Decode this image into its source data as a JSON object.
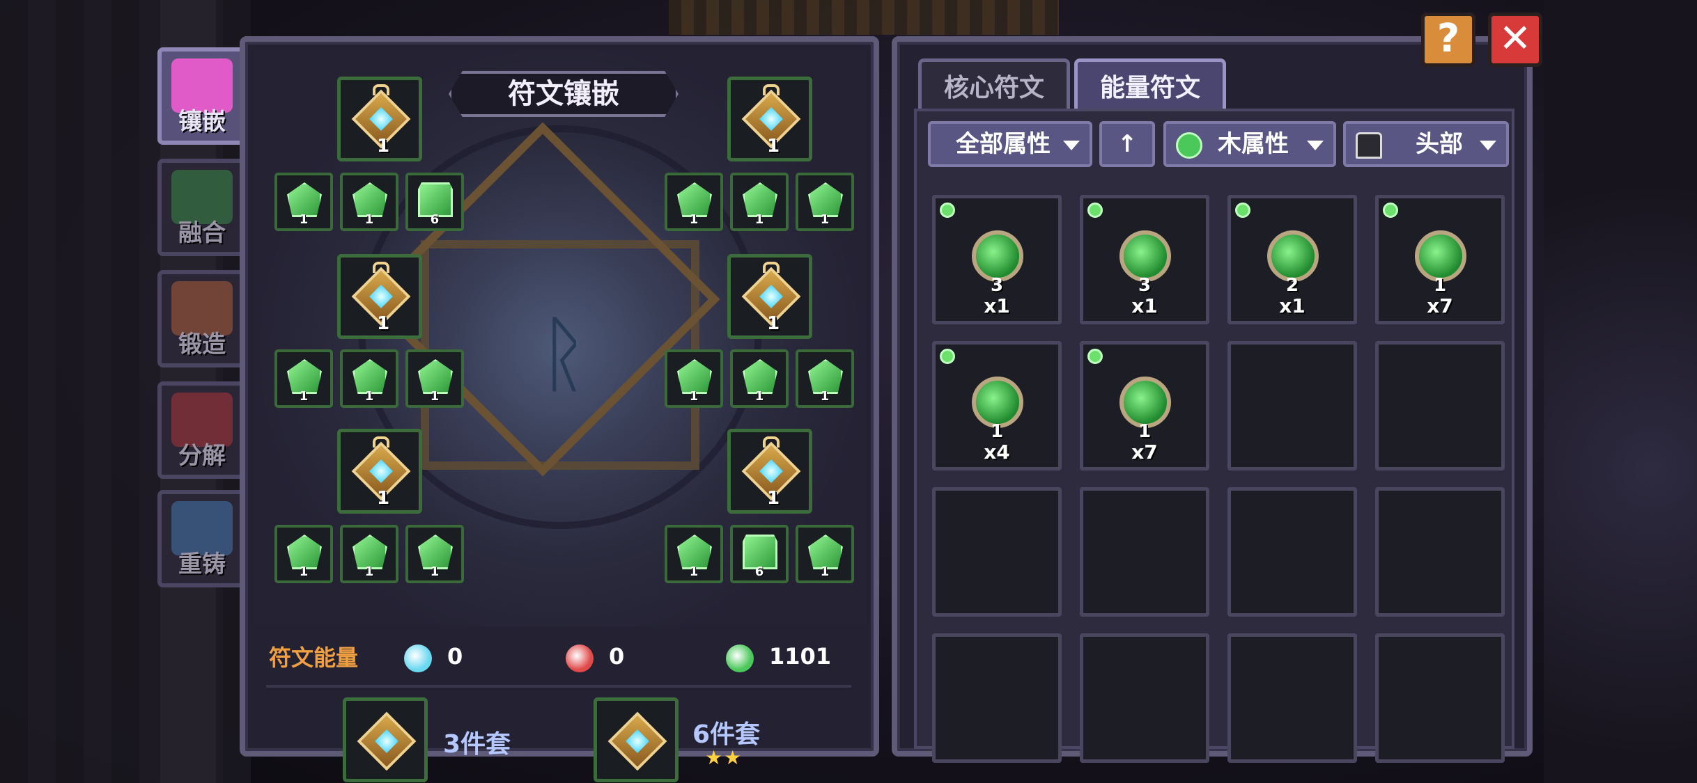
{
  "side_tabs": [
    {
      "label": "镶嵌",
      "active": true,
      "color": "#e05ac8"
    },
    {
      "label": "融合",
      "active": false,
      "color": "#3aa04a"
    },
    {
      "label": "锻造",
      "active": false,
      "color": "#c86a3a"
    },
    {
      "label": "分解",
      "active": false,
      "color": "#c83a3a"
    },
    {
      "label": "重铸",
      "active": false,
      "color": "#4a8ac8"
    }
  ],
  "left": {
    "title": "符文镶嵌",
    "core_slots": [
      {
        "level": "1"
      },
      {
        "level": "1"
      },
      {
        "level": "1"
      },
      {
        "level": "1"
      },
      {
        "level": "1"
      },
      {
        "level": "1"
      }
    ],
    "rune_slots": [
      {
        "level": "1",
        "shape": "leaf"
      },
      {
        "level": "1",
        "shape": "leaf"
      },
      {
        "level": "6",
        "shape": "rect"
      },
      {
        "level": "1",
        "shape": "leaf"
      },
      {
        "level": "1",
        "shape": "leaf"
      },
      {
        "level": "1",
        "shape": "leaf"
      },
      {
        "level": "1",
        "shape": "leaf"
      },
      {
        "level": "1",
        "shape": "leaf"
      },
      {
        "level": "1",
        "shape": "leaf"
      },
      {
        "level": "1",
        "shape": "leaf"
      },
      {
        "level": "1",
        "shape": "leaf"
      },
      {
        "level": "1",
        "shape": "leaf"
      },
      {
        "level": "1",
        "shape": "leaf"
      },
      {
        "level": "1",
        "shape": "leaf"
      },
      {
        "level": "1",
        "shape": "leaf"
      },
      {
        "level": "1",
        "shape": "leaf"
      },
      {
        "level": "6",
        "shape": "rect"
      },
      {
        "level": "1",
        "shape": "leaf"
      }
    ],
    "energy_label": "符文能量",
    "energy": [
      {
        "icon": "water-drop-icon",
        "value": "0",
        "color": "#6ad8f0"
      },
      {
        "icon": "fire-drop-icon",
        "value": "0",
        "color": "#e04a4a"
      },
      {
        "icon": "wood-drop-icon",
        "value": "1101",
        "color": "#4ac85a"
      }
    ],
    "sets": [
      {
        "label": "3件套",
        "stars": ""
      },
      {
        "label": "6件套",
        "stars": "★★"
      }
    ]
  },
  "right": {
    "tabs": [
      {
        "label": "核心符文",
        "active": false
      },
      {
        "label": "能量符文",
        "active": true
      }
    ],
    "filters": {
      "all_attr": "全部属性",
      "sort_icon": "up-arrow-icon",
      "wood_attr": "木属性",
      "slot": "头部"
    },
    "items": [
      {
        "level": "3",
        "qty": "x1",
        "new": true
      },
      {
        "level": "3",
        "qty": "x1",
        "new": true
      },
      {
        "level": "2",
        "qty": "x1",
        "new": true
      },
      {
        "level": "1",
        "qty": "x7",
        "new": true
      },
      {
        "level": "1",
        "qty": "x4",
        "new": true
      },
      {
        "level": "1",
        "qty": "x7",
        "new": true
      }
    ]
  },
  "buttons": {
    "help": "?",
    "close": "✕"
  }
}
